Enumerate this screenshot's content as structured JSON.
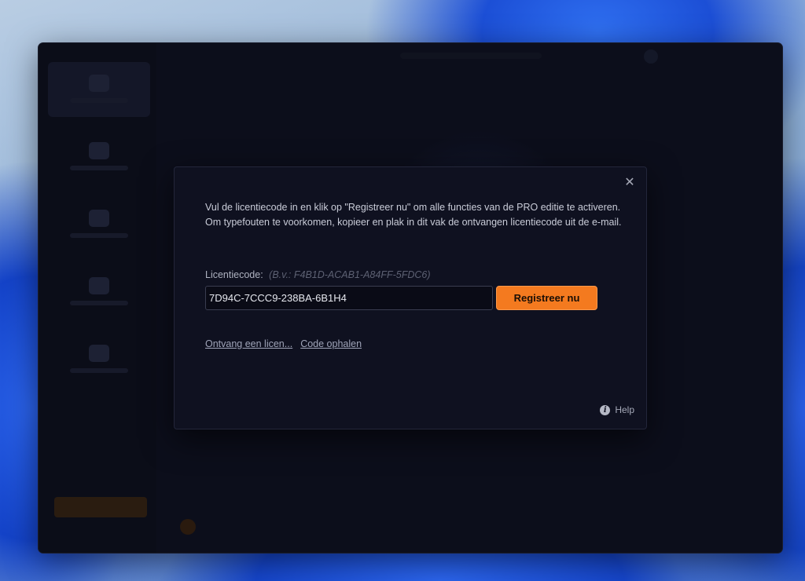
{
  "dialog": {
    "intro": "Vul de licentiecode in en klik op \"Registreer nu\" om alle functies van de PRO editie te activeren. Om typefouten te voorkomen, kopieer en plak in dit vak de ontvangen licentiecode uit de e-mail.",
    "code_label": "Licentiecode:",
    "code_example": "(B.v.: F4B1D-ACAB1-A84FF-5FDC6)",
    "code_value": "7D94C-7CCC9-238BA-6B1H4",
    "register_label": "Registreer nu",
    "link_get_license": "Ontvang een licen...",
    "link_retrieve_code": "Code ophalen",
    "help_label": "Help",
    "close_glyph": "✕"
  },
  "icons": {
    "close": "close-icon",
    "info": "info-icon"
  },
  "colors": {
    "accent": "#f47a1f",
    "dialog_bg": "#0f1120",
    "window_bg": "#0c0e1b"
  }
}
